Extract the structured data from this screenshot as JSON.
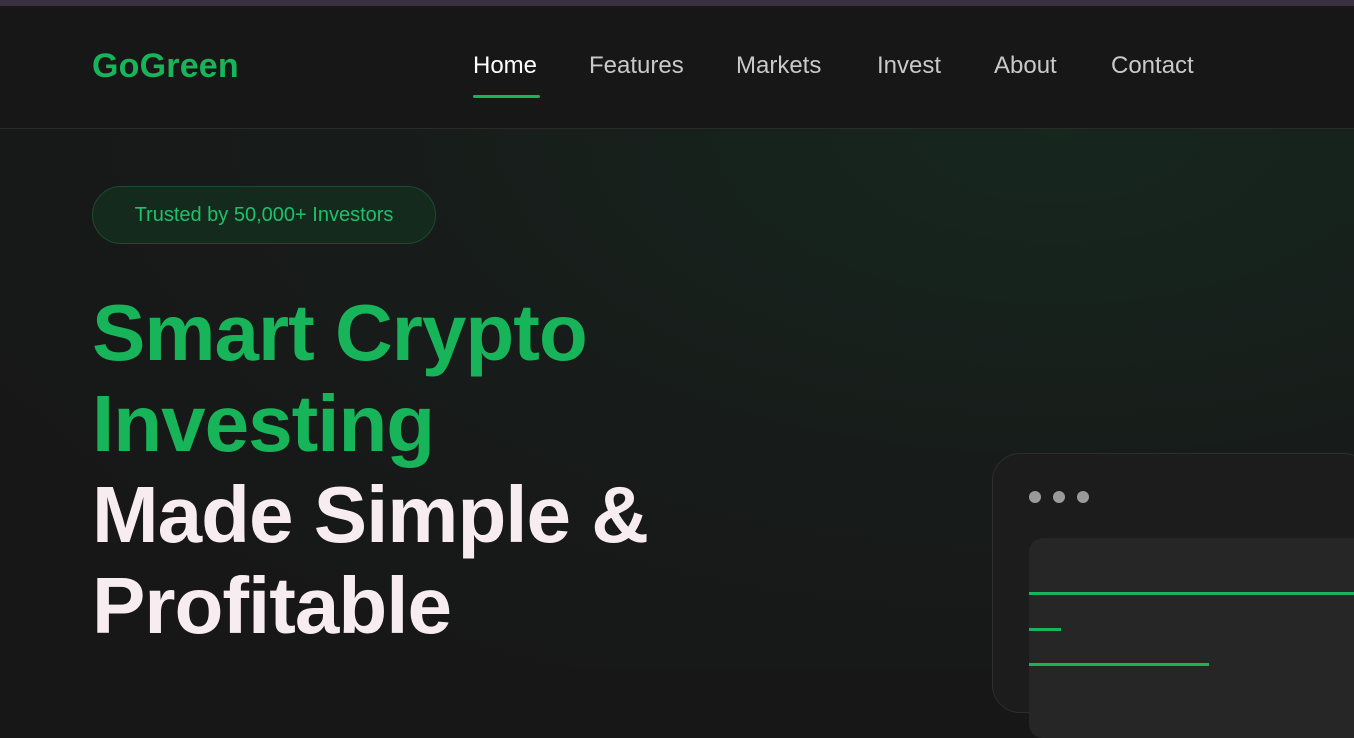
{
  "brand": {
    "name": "GoGreen",
    "accent_color": "#17b45a"
  },
  "nav": {
    "items": [
      {
        "label": "Home",
        "active": true
      },
      {
        "label": "Features",
        "active": false
      },
      {
        "label": "Markets",
        "active": false
      },
      {
        "label": "Invest",
        "active": false
      },
      {
        "label": "About",
        "active": false
      },
      {
        "label": "Contact",
        "active": false
      }
    ]
  },
  "hero": {
    "badge": "Trusted by 50,000+ Investors",
    "headline": {
      "line1": "Smart Crypto",
      "line2": "Investing",
      "line3": "Made Simple &",
      "line4": "Profitable"
    }
  },
  "preview_window": {
    "window_dots": 3,
    "bar_fill_fractions": [
      1.0,
      0.09,
      0.5
    ]
  }
}
